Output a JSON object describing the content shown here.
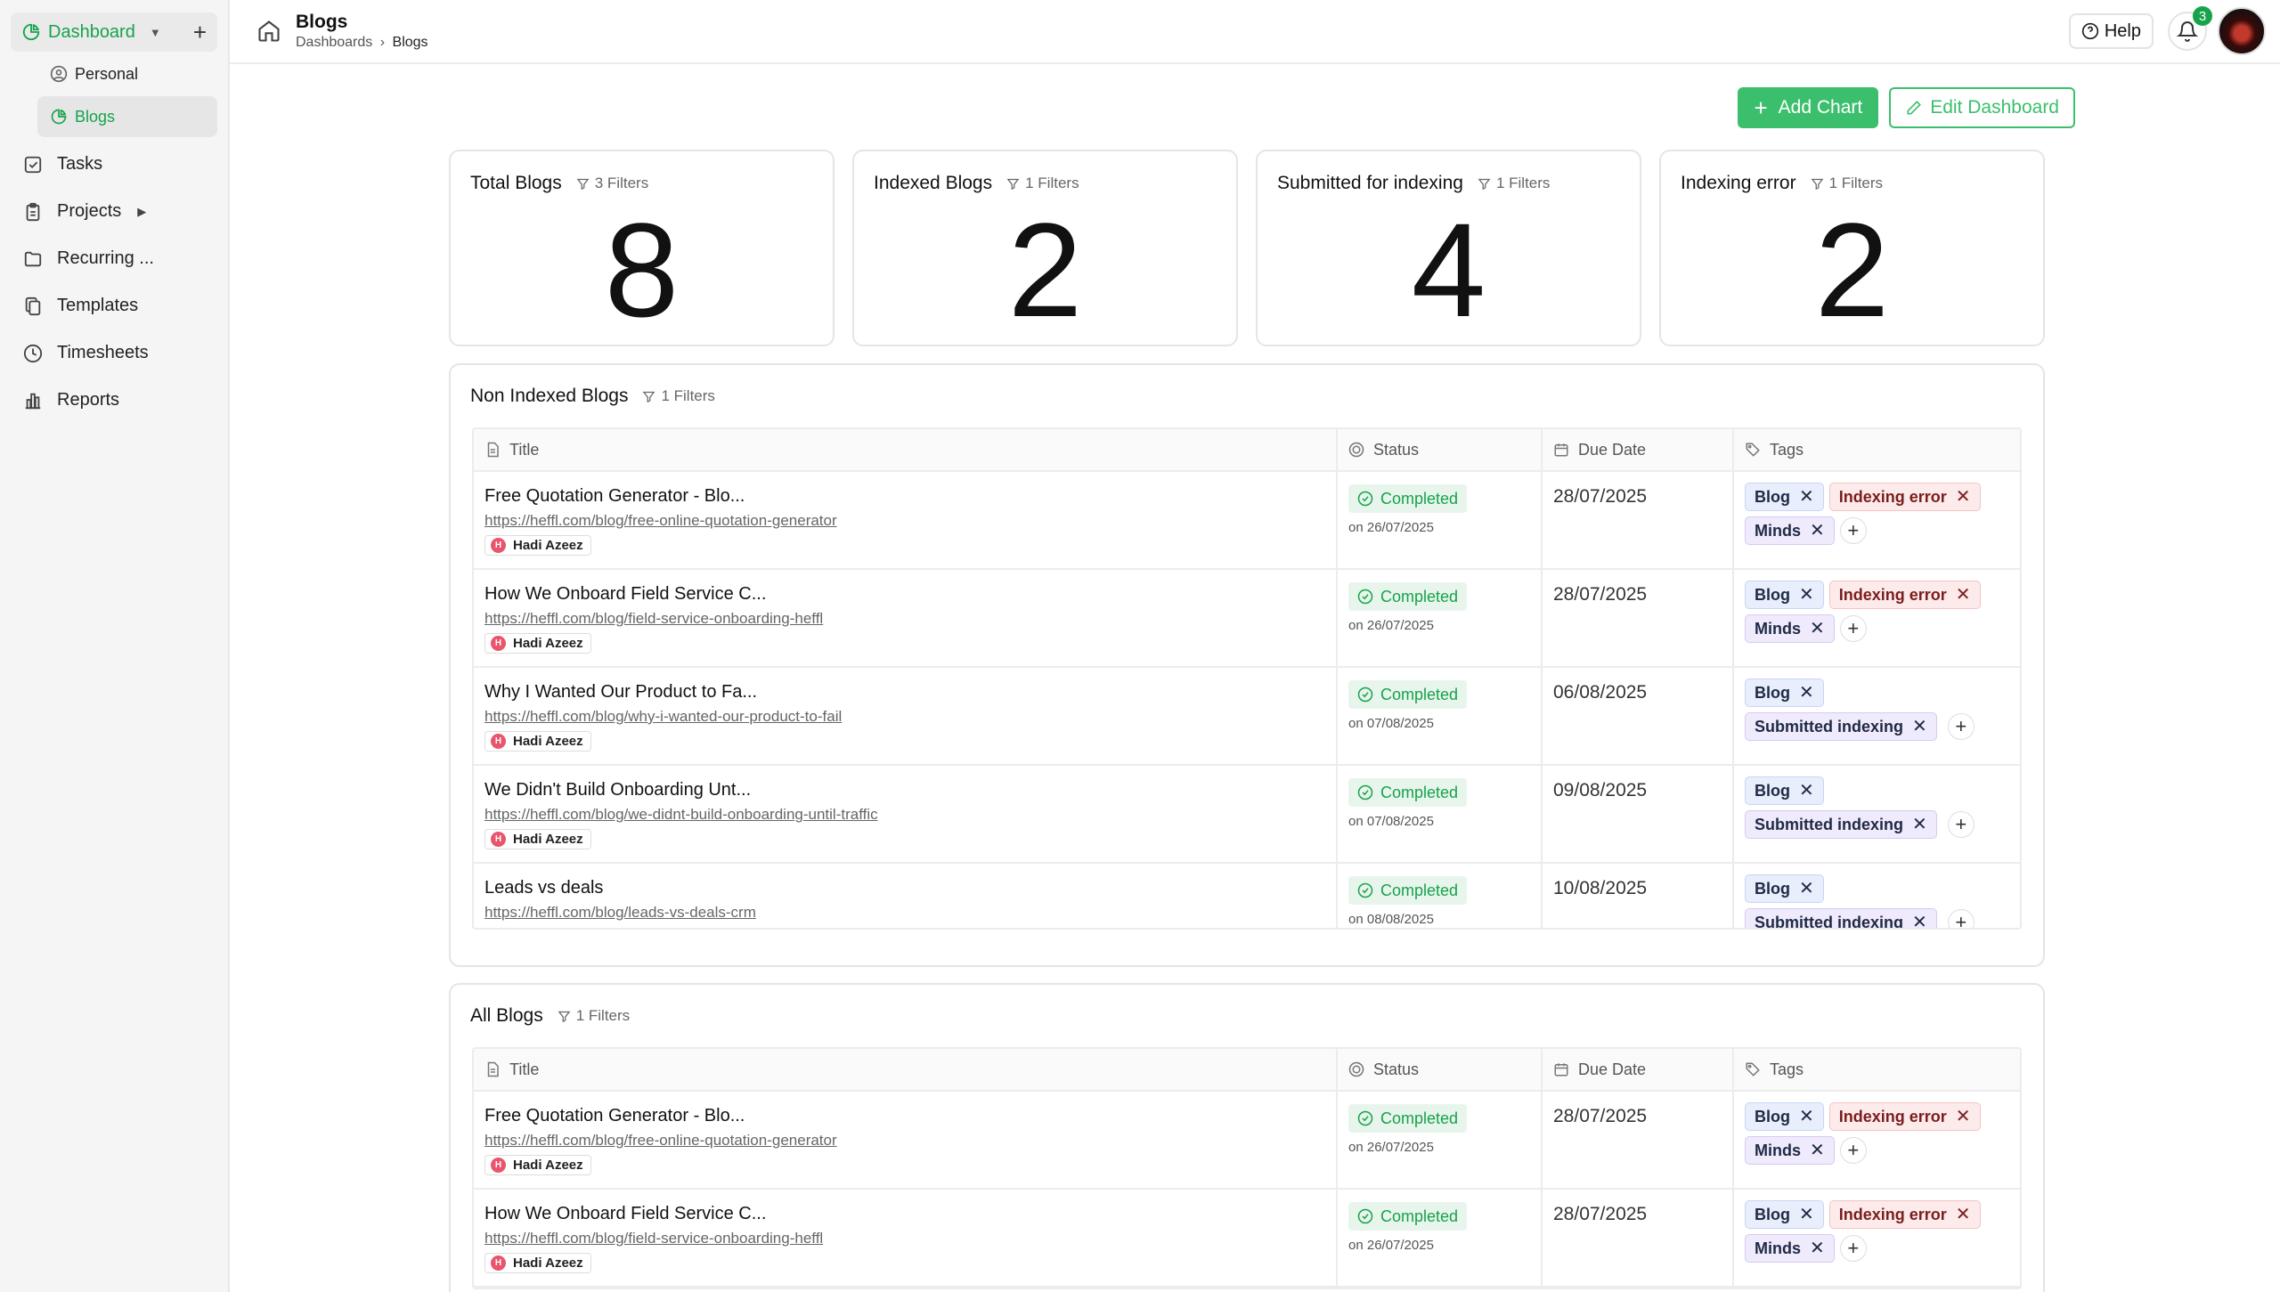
{
  "sidebar": {
    "dashboard_label": "Dashboard",
    "sub_items": [
      {
        "label": "Personal"
      },
      {
        "label": "Blogs"
      }
    ],
    "items": [
      {
        "label": "Tasks"
      },
      {
        "label": "Projects"
      },
      {
        "label": "Recurring ..."
      },
      {
        "label": "Templates"
      },
      {
        "label": "Timesheets"
      },
      {
        "label": "Reports"
      }
    ]
  },
  "header": {
    "title": "Blogs",
    "breadcrumb": {
      "root": "Dashboards",
      "current": "Blogs"
    },
    "help_label": "Help",
    "notification_count": "3"
  },
  "actions": {
    "add_chart": "Add Chart",
    "edit_dashboard": "Edit Dashboard"
  },
  "stats": [
    {
      "label": "Total Blogs",
      "filters": "3 Filters",
      "value": "8"
    },
    {
      "label": "Indexed Blogs",
      "filters": "1 Filters",
      "value": "2"
    },
    {
      "label": "Submitted for indexing",
      "filters": "1 Filters",
      "value": "4"
    },
    {
      "label": "Indexing error",
      "filters": "1 Filters",
      "value": "2"
    }
  ],
  "columns": {
    "title": "Title",
    "status": "Status",
    "due": "Due Date",
    "tags": "Tags"
  },
  "non_indexed": {
    "title": "Non Indexed Blogs",
    "filters": "1 Filters",
    "rows": [
      {
        "title": "Free Quotation Generator - Blo...",
        "url": "https://heffl.com/blog/free-online-quotation-generator",
        "assignee": "Hadi Azeez",
        "status": "Completed",
        "status_date": "on 26/07/2025",
        "due": "28/07/2025",
        "tag1": "Blog",
        "tag2": "Indexing error",
        "tag3": "Minds"
      },
      {
        "title": "How We Onboard Field Service C...",
        "url": "https://heffl.com/blog/field-service-onboarding-heffl",
        "assignee": "Hadi Azeez",
        "status": "Completed",
        "status_date": "on 26/07/2025",
        "due": "28/07/2025",
        "tag1": "Blog",
        "tag2": "Indexing error",
        "tag3": "Minds"
      },
      {
        "title": "Why I Wanted Our Product to Fa...",
        "url": "https://heffl.com/blog/why-i-wanted-our-product-to-fail",
        "assignee": "Hadi Azeez",
        "status": "Completed",
        "status_date": "on 07/08/2025",
        "due": "06/08/2025",
        "tag1": "Blog",
        "tag2": "Submitted indexing"
      },
      {
        "title": "We Didn't Build Onboarding Unt...",
        "url": "https://heffl.com/blog/we-didnt-build-onboarding-until-traffic",
        "assignee": "Hadi Azeez",
        "status": "Completed",
        "status_date": "on 07/08/2025",
        "due": "09/08/2025",
        "tag1": "Blog",
        "tag2": "Submitted indexing"
      },
      {
        "title": "Leads vs deals",
        "url": "https://heffl.com/blog/leads-vs-deals-crm",
        "status": "Completed",
        "status_date": "on 08/08/2025",
        "due": "10/08/2025",
        "tag1": "Blog",
        "tag2": "Submitted indexing"
      }
    ]
  },
  "all_blogs": {
    "title": "All Blogs",
    "filters": "1 Filters",
    "rows": [
      {
        "title": "Free Quotation Generator - Blo...",
        "url": "https://heffl.com/blog/free-online-quotation-generator",
        "assignee": "Hadi Azeez",
        "status": "Completed",
        "status_date": "on 26/07/2025",
        "due": "28/07/2025",
        "tag1": "Blog",
        "tag2": "Indexing error",
        "tag3": "Minds"
      },
      {
        "title": "How We Onboard Field Service C...",
        "url": "https://heffl.com/blog/field-service-onboarding-heffl",
        "assignee": "Hadi Azeez",
        "status": "Completed",
        "status_date": "on 26/07/2025",
        "due": "28/07/2025",
        "tag1": "Blog",
        "tag2": "Indexing error",
        "tag3": "Minds"
      }
    ]
  },
  "colors": {
    "accent": "#16a34a",
    "button": "#3bbf6d"
  }
}
